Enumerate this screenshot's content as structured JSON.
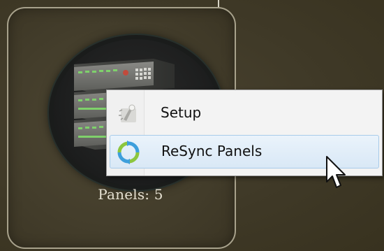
{
  "tile": {
    "panels_label": "Panels: 5"
  },
  "context_menu": {
    "items": [
      {
        "label": "Setup",
        "icon": "setup-wizard-icon"
      },
      {
        "label": "ReSync Panels",
        "icon": "resync-icon",
        "highlighted": true
      }
    ]
  },
  "colors": {
    "background": "#403a28",
    "tile_border": "#a8a28c",
    "menu_bg": "#f3f3f3",
    "highlight_border": "#a8cbe9",
    "panel_led": "#7fd16b"
  }
}
